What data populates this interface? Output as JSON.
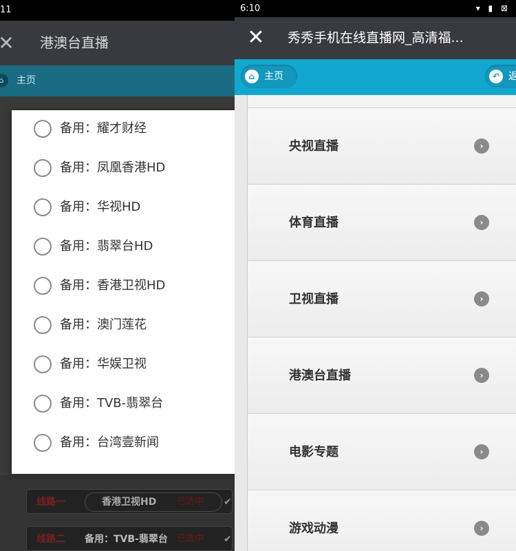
{
  "left": {
    "status_time": "11",
    "title": "港澳台直播",
    "nav_home": "主页",
    "dialog_options": [
      "备用：耀才财经",
      "备用：凤凰香港HD",
      "备用：华视HD",
      "备用：翡翠台HD",
      "备用：香港卫视HD",
      "备用：澳门莲花",
      "备用：华娱卫视",
      "备用：TVB-翡翠台",
      "备用：台湾壹新闻"
    ],
    "lines": [
      {
        "label": "线路一",
        "value": "香港卫视HD",
        "tag": "已选中"
      },
      {
        "label": "线路二",
        "value": "备用：TVB-翡翠台",
        "tag": "已选中"
      }
    ]
  },
  "right": {
    "status_time": "6:10",
    "status_icons": "▾ ▮ ⊠",
    "title": "秀秀手机在线直播网_高清福...",
    "nav_home": "主页",
    "nav_back": "返",
    "menu": [
      "央视直播",
      "体育直播",
      "卫视直播",
      "港澳台直播",
      "电影专题",
      "游戏动漫"
    ]
  }
}
